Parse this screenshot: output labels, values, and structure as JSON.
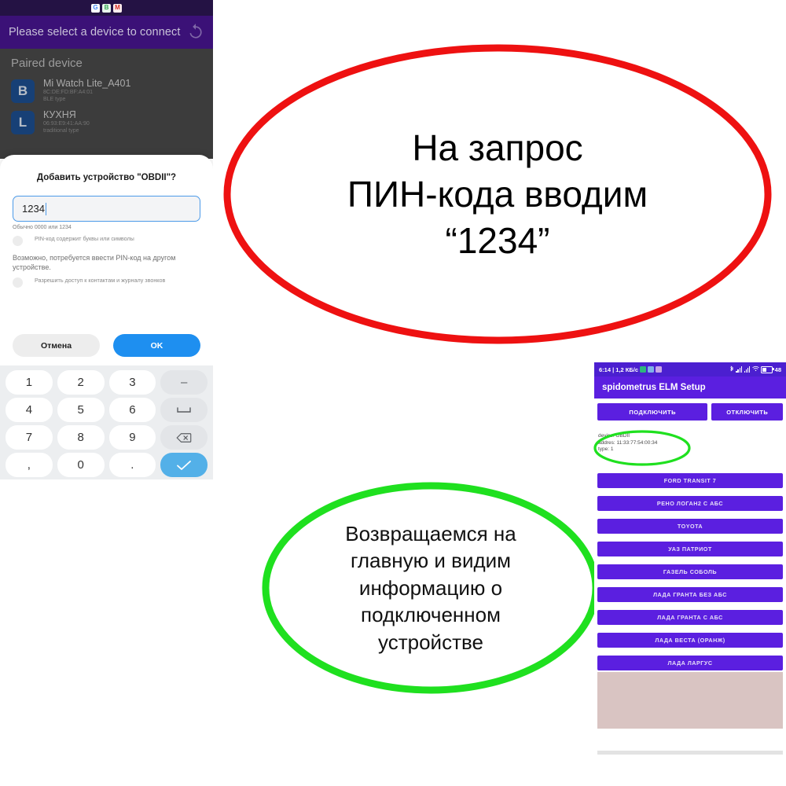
{
  "left_phone": {
    "status_bar": {
      "icons": [
        "google-chip-icon",
        "bluetooth-chip-icon",
        "gmail-chip-icon"
      ],
      "g_label": "G",
      "b_label": "B",
      "m_label": "M"
    },
    "app_bar": {
      "title": "Please select a device to connect",
      "refresh_icon": "refresh-icon"
    },
    "paired_section": {
      "heading": "Paired device",
      "devices": [
        {
          "avatar": "B",
          "name": "Mi Watch Lite_A401",
          "address": "8C:DE:FD:BF:A4:01",
          "type": "BLE type"
        },
        {
          "avatar": "L",
          "name": "КУХНЯ",
          "address": "06:93:E9:41:AA:90",
          "type": "traditional type"
        }
      ]
    },
    "dialog": {
      "title": "Добавить устройство \"OBDII\"?",
      "pin_value": "1234",
      "helper": "Обычно 0000 или 1234",
      "checkbox_pin_symbols": "PIN-код содержит буквы или символы",
      "note": "Возможно, потребуется ввести PIN-код на другом устройстве.",
      "checkbox_contacts": "Разрешить доступ к контактам и журналу звонков",
      "cancel_label": "Отмена",
      "ok_label": "OK"
    },
    "keypad": {
      "rows": [
        [
          "1",
          "2",
          "3",
          "minus"
        ],
        [
          "4",
          "5",
          "6",
          "space"
        ],
        [
          "7",
          "8",
          "9",
          "backspace"
        ],
        [
          ",",
          "0",
          ".",
          "enter"
        ]
      ],
      "minus_label": "–",
      "space_label": "space-icon",
      "backspace_label": "backspace-icon",
      "enter_label": "check-icon"
    }
  },
  "red_callout": {
    "color": "#ee1111",
    "lines": [
      "На запрос",
      "ПИН-кода вводим",
      "“1234”"
    ]
  },
  "green_callout": {
    "color": "#1fe01f",
    "lines": [
      "Возвращаемся на",
      "главную и видим",
      "информацию о",
      "подключенном",
      "устройстве"
    ]
  },
  "right_phone": {
    "status_bar": {
      "left_text": "6:14 | 1,2 КБ/c",
      "battery_text": "48",
      "icons": [
        "bluetooth-icon",
        "signal-icon",
        "signal-icon",
        "wifi-icon",
        "battery-icon"
      ]
    },
    "title": "spidometrus ELM Setup",
    "buttons": {
      "connect": "ПОДКЛЮЧИТЬ",
      "disconnect": "ОТКЛЮЧИТЬ"
    },
    "device_info": {
      "device": "device:  OBDII",
      "address": "addres: 11:33:77:54:00:34",
      "type": "type:  1"
    },
    "car_list": [
      "FORD TRANSIT 7",
      "РЕНО ЛОГАН2 С АБС",
      "TOYOTA",
      "УАЗ ПАТРИОТ",
      "ГАЗЕЛЬ СОБОЛЬ",
      "ЛАДА ГРАНТА БЕЗ АБС",
      "ЛАДА ГРАНТА С АБС",
      "ЛАДА ВЕСТА (ОРАНЖ)",
      "ЛАДА ЛАРГУС"
    ],
    "accent": "#5b1fe0",
    "panel_color": "#d9c4c2"
  }
}
